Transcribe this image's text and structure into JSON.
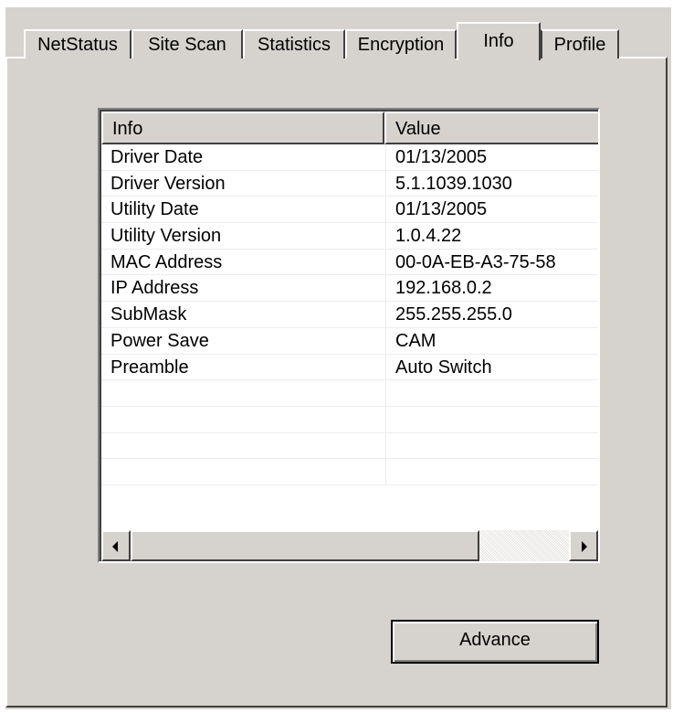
{
  "tabs": [
    {
      "label": "NetStatus",
      "active": false
    },
    {
      "label": "Site Scan",
      "active": false
    },
    {
      "label": "Statistics",
      "active": false
    },
    {
      "label": "Encryption",
      "active": false
    },
    {
      "label": "Info",
      "active": true
    },
    {
      "label": "Profile",
      "active": false
    }
  ],
  "table": {
    "columns": [
      "Info",
      "Value"
    ],
    "rows": [
      {
        "info": "Driver Date",
        "value": "01/13/2005"
      },
      {
        "info": "Driver Version",
        "value": "5.1.1039.1030"
      },
      {
        "info": "Utility Date",
        "value": "01/13/2005"
      },
      {
        "info": "Utility Version",
        "value": "1.0.4.22"
      },
      {
        "info": "MAC Address",
        "value": "00-0A-EB-A3-75-58"
      },
      {
        "info": "IP Address",
        "value": "192.168.0.2"
      },
      {
        "info": "SubMask",
        "value": "255.255.255.0"
      },
      {
        "info": "Power Save",
        "value": "CAM"
      },
      {
        "info": "Preamble",
        "value": "Auto Switch"
      },
      {
        "info": "",
        "value": ""
      },
      {
        "info": "",
        "value": ""
      },
      {
        "info": "",
        "value": ""
      },
      {
        "info": "",
        "value": ""
      },
      {
        "info": "",
        "value": ""
      }
    ]
  },
  "buttons": {
    "advance_label": "Advance"
  },
  "icons": {
    "scroll_left": "arrow-left-icon",
    "scroll_right": "arrow-right-icon"
  },
  "colors": {
    "face": "#d6d3ce",
    "list_background": "#ffffff"
  }
}
